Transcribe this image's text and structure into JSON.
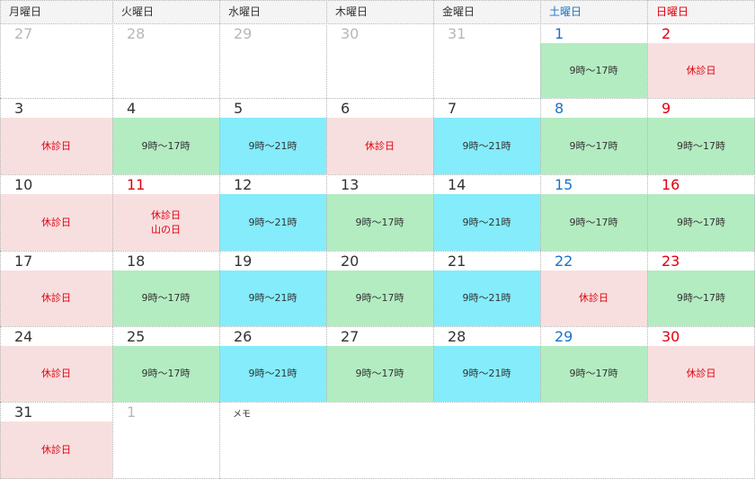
{
  "colors": {
    "closed_bg": "#f8dfdf",
    "short_hours_bg": "#b3ecc1",
    "long_hours_bg": "#84ecfb",
    "saturday": "#1a73c7",
    "sunday_holiday": "#e0000f",
    "other_month": "#b8b8b8"
  },
  "headers": [
    {
      "label": "月曜日",
      "kind": "weekday"
    },
    {
      "label": "火曜日",
      "kind": "weekday"
    },
    {
      "label": "水曜日",
      "kind": "weekday"
    },
    {
      "label": "木曜日",
      "kind": "weekday"
    },
    {
      "label": "金曜日",
      "kind": "weekday"
    },
    {
      "label": "土曜日",
      "kind": "sat"
    },
    {
      "label": "日曜日",
      "kind": "sun"
    }
  ],
  "weeks": [
    [
      {
        "day": "27",
        "numKind": "other",
        "status": [],
        "bg": ""
      },
      {
        "day": "28",
        "numKind": "other",
        "status": [],
        "bg": ""
      },
      {
        "day": "29",
        "numKind": "other",
        "status": [],
        "bg": ""
      },
      {
        "day": "30",
        "numKind": "other",
        "status": [],
        "bg": ""
      },
      {
        "day": "31",
        "numKind": "other",
        "status": [],
        "bg": ""
      },
      {
        "day": "1",
        "numKind": "sat",
        "status": [
          "9時～17時"
        ],
        "bg": "green"
      },
      {
        "day": "2",
        "numKind": "sun",
        "status": [
          "休診日"
        ],
        "bg": "pink"
      }
    ],
    [
      {
        "day": "3",
        "numKind": "normal",
        "status": [
          "休診日"
        ],
        "bg": "pink"
      },
      {
        "day": "4",
        "numKind": "normal",
        "status": [
          "9時～17時"
        ],
        "bg": "green"
      },
      {
        "day": "5",
        "numKind": "normal",
        "status": [
          "9時～21時"
        ],
        "bg": "cyan"
      },
      {
        "day": "6",
        "numKind": "normal",
        "status": [
          "休診日"
        ],
        "bg": "pink"
      },
      {
        "day": "7",
        "numKind": "normal",
        "status": [
          "9時～21時"
        ],
        "bg": "cyan"
      },
      {
        "day": "8",
        "numKind": "sat",
        "status": [
          "9時～17時"
        ],
        "bg": "green"
      },
      {
        "day": "9",
        "numKind": "sun",
        "status": [
          "9時～17時"
        ],
        "bg": "green"
      }
    ],
    [
      {
        "day": "10",
        "numKind": "normal",
        "status": [
          "休診日"
        ],
        "bg": "pink"
      },
      {
        "day": "11",
        "numKind": "sun",
        "status": [
          "休診日",
          "山の日"
        ],
        "bg": "pink"
      },
      {
        "day": "12",
        "numKind": "normal",
        "status": [
          "9時～21時"
        ],
        "bg": "cyan"
      },
      {
        "day": "13",
        "numKind": "normal",
        "status": [
          "9時～17時"
        ],
        "bg": "green"
      },
      {
        "day": "14",
        "numKind": "normal",
        "status": [
          "9時～21時"
        ],
        "bg": "cyan"
      },
      {
        "day": "15",
        "numKind": "sat",
        "status": [
          "9時～17時"
        ],
        "bg": "green"
      },
      {
        "day": "16",
        "numKind": "sun",
        "status": [
          "9時～17時"
        ],
        "bg": "green"
      }
    ],
    [
      {
        "day": "17",
        "numKind": "normal",
        "status": [
          "休診日"
        ],
        "bg": "pink"
      },
      {
        "day": "18",
        "numKind": "normal",
        "status": [
          "9時～17時"
        ],
        "bg": "green"
      },
      {
        "day": "19",
        "numKind": "normal",
        "status": [
          "9時～21時"
        ],
        "bg": "cyan"
      },
      {
        "day": "20",
        "numKind": "normal",
        "status": [
          "9時～17時"
        ],
        "bg": "green"
      },
      {
        "day": "21",
        "numKind": "normal",
        "status": [
          "9時～21時"
        ],
        "bg": "cyan"
      },
      {
        "day": "22",
        "numKind": "sat",
        "status": [
          "休診日"
        ],
        "bg": "pink"
      },
      {
        "day": "23",
        "numKind": "sun",
        "status": [
          "9時～17時"
        ],
        "bg": "green"
      }
    ],
    [
      {
        "day": "24",
        "numKind": "normal",
        "status": [
          "休診日"
        ],
        "bg": "pink"
      },
      {
        "day": "25",
        "numKind": "normal",
        "status": [
          "9時～17時"
        ],
        "bg": "green"
      },
      {
        "day": "26",
        "numKind": "normal",
        "status": [
          "9時～21時"
        ],
        "bg": "cyan"
      },
      {
        "day": "27",
        "numKind": "normal",
        "status": [
          "9時～17時"
        ],
        "bg": "green"
      },
      {
        "day": "28",
        "numKind": "normal",
        "status": [
          "9時～21時"
        ],
        "bg": "cyan"
      },
      {
        "day": "29",
        "numKind": "sat",
        "status": [
          "9時～17時"
        ],
        "bg": "green"
      },
      {
        "day": "30",
        "numKind": "sun",
        "status": [
          "休診日"
        ],
        "bg": "pink"
      }
    ],
    [
      {
        "day": "31",
        "numKind": "normal",
        "status": [
          "休診日"
        ],
        "bg": "pink"
      },
      {
        "day": "1",
        "numKind": "other",
        "status": [],
        "bg": ""
      }
    ]
  ],
  "memo_label": "メモ"
}
